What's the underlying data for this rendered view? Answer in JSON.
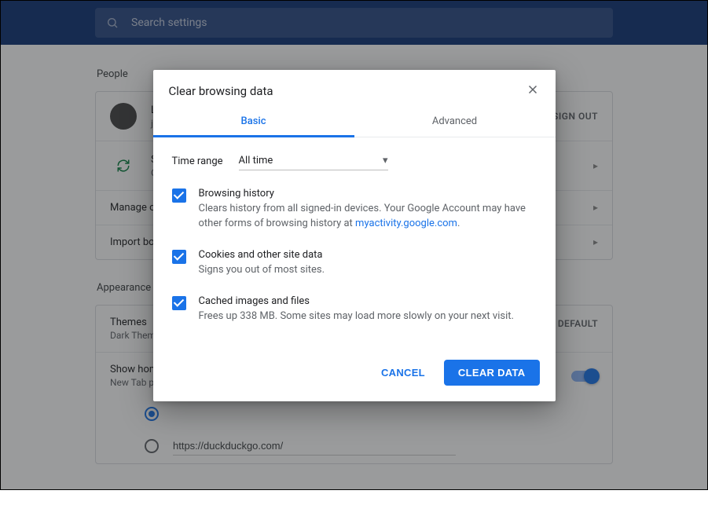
{
  "search": {
    "placeholder": "Search settings"
  },
  "people": {
    "section_title": "People",
    "profile_name": "L",
    "profile_sub": "ja",
    "sign_out": "SIGN OUT",
    "sync_label": "S",
    "sync_sub": "O",
    "manage_label": "Manage ot",
    "import_label": "Import boo"
  },
  "appearance": {
    "section_title": "Appearance",
    "themes_label": "Themes",
    "themes_sub": "Dark Them",
    "reset": "O DEFAULT",
    "home_label": "Show home",
    "home_sub": "New Tab pa",
    "url_value": "https://duckduckgo.com/"
  },
  "dialog": {
    "title": "Clear browsing data",
    "tab_basic": "Basic",
    "tab_advanced": "Advanced",
    "time_label": "Time range",
    "time_value": "All time",
    "opt1_title": "Browsing history",
    "opt1_desc_a": "Clears history from all signed-in devices. Your Google Account may have other forms of browsing history at ",
    "opt1_link": "myactivity.google.com",
    "opt1_desc_b": ".",
    "opt2_title": "Cookies and other site data",
    "opt2_desc": "Signs you out of most sites.",
    "opt3_title": "Cached images and files",
    "opt3_desc": "Frees up 338 MB. Some sites may load more slowly on your next visit.",
    "cancel": "CANCEL",
    "confirm": "CLEAR DATA"
  }
}
